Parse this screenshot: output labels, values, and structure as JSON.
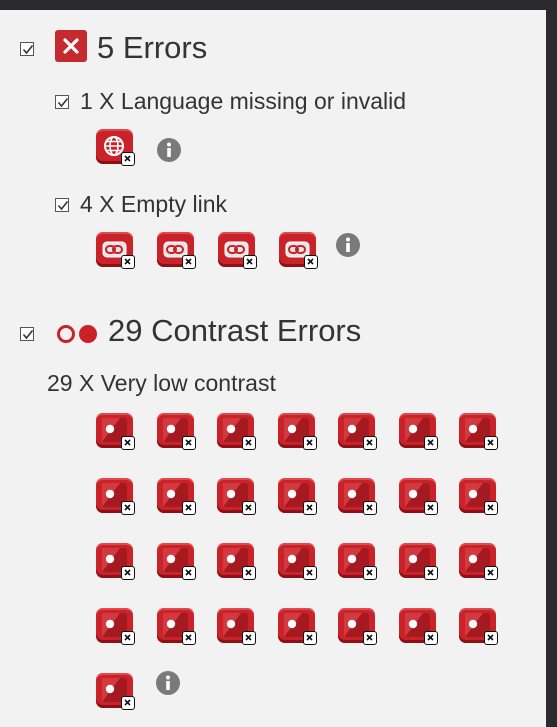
{
  "errors": {
    "heading": "5 Errors",
    "groups": [
      {
        "label": "1 X Language missing or invalid",
        "icon": "globe-icon",
        "count": 1
      },
      {
        "label": "4 X Empty link",
        "icon": "link-icon",
        "count": 4
      }
    ]
  },
  "contrast": {
    "heading": "29 Contrast Errors",
    "group_label": "29 X Very low contrast",
    "count": 29,
    "icon": "contrast-icon"
  },
  "icons": {
    "checkbox": "checkbox-checked-icon",
    "error_badge": "error-x-icon",
    "info": "info-icon",
    "contrast_dots": "contrast-dots-icon"
  },
  "colors": {
    "error_red": "#c92229",
    "panel_bg": "#f2f2f2",
    "frame_bg": "#2b2b2d"
  }
}
